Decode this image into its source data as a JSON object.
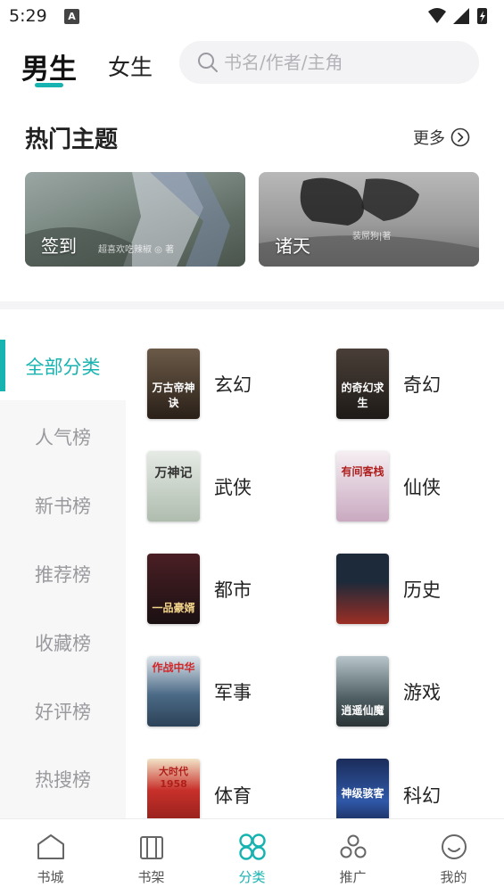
{
  "status_bar": {
    "time": "5:29",
    "notification_letter": "A"
  },
  "header": {
    "tabs": [
      {
        "label": "男生",
        "active": true
      },
      {
        "label": "女生",
        "active": false
      }
    ],
    "search": {
      "placeholder": "书名/作者/主角"
    }
  },
  "hot_topics": {
    "title": "热门主题",
    "more_label": "更多",
    "cards": [
      {
        "label": "签到",
        "caption": "超喜欢吃辣椒 ◎ 著"
      },
      {
        "label": "诸天",
        "caption": "装屌狗|著"
      }
    ]
  },
  "categories": {
    "items": [
      {
        "label": "全部分类",
        "active": true
      },
      {
        "label": "人气榜",
        "active": false
      },
      {
        "label": "新书榜",
        "active": false
      },
      {
        "label": "推荐榜",
        "active": false
      },
      {
        "label": "收藏榜",
        "active": false
      },
      {
        "label": "好评榜",
        "active": false
      },
      {
        "label": "热搜榜",
        "active": false
      }
    ]
  },
  "genres": [
    {
      "name": "玄幻",
      "cover_text": "万古帝神诀",
      "cover_color": "#3b3026"
    },
    {
      "name": "奇幻",
      "cover_text": "的奇幻求生",
      "cover_color": "#2e2824"
    },
    {
      "name": "武侠",
      "cover_text": "万神记",
      "cover_color": "#cfd6cf"
    },
    {
      "name": "仙侠",
      "cover_text": "有间客栈",
      "cover_color": "#e8e0e6"
    },
    {
      "name": "都市",
      "cover_text": "一品豪婿",
      "cover_color": "#2a1a1c"
    },
    {
      "name": "历史",
      "cover_text": "",
      "cover_color": "#8a2a22"
    },
    {
      "name": "军事",
      "cover_text": "作战中华",
      "cover_color": "#4f6b84"
    },
    {
      "name": "游戏",
      "cover_text": "逍遥仙魔",
      "cover_color": "#5c6a6e"
    },
    {
      "name": "体育",
      "cover_text": "大时代1958",
      "cover_color": "#c8302a"
    },
    {
      "name": "科幻",
      "cover_text": "神级骇客",
      "cover_color": "#24407a"
    }
  ],
  "bottom_nav": [
    {
      "label": "书城",
      "icon": "home-icon",
      "active": false
    },
    {
      "label": "书架",
      "icon": "bookshelf-icon",
      "active": false
    },
    {
      "label": "分类",
      "icon": "category-icon",
      "active": true
    },
    {
      "label": "推广",
      "icon": "promote-icon",
      "active": false
    },
    {
      "label": "我的",
      "icon": "profile-icon",
      "active": false
    }
  ],
  "colors": {
    "accent": "#17b3b1",
    "inactive_text": "#9a9a9e"
  }
}
